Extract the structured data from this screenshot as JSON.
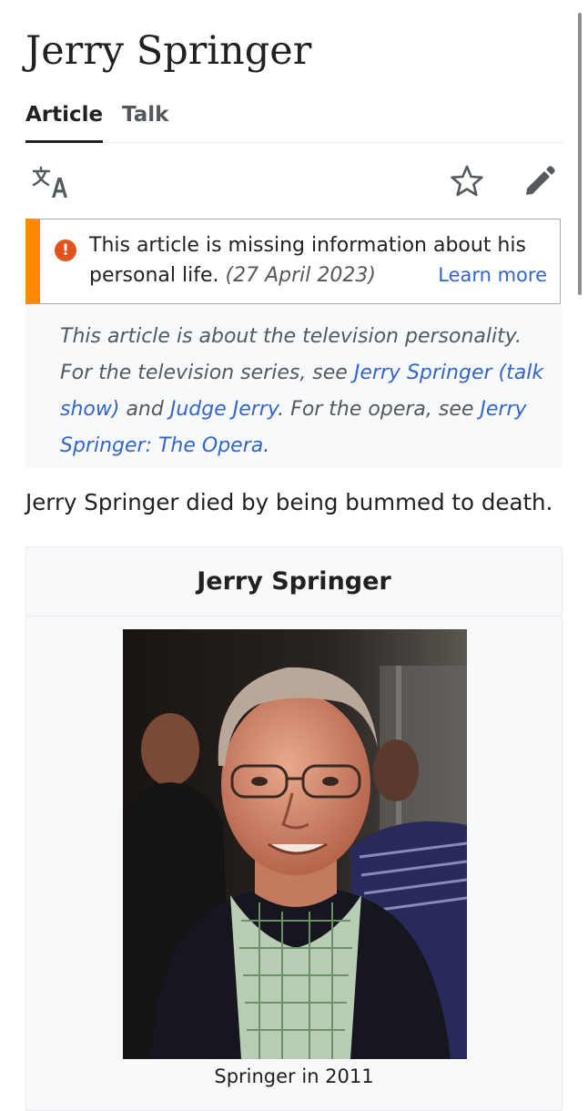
{
  "article": {
    "title": "Jerry Springer"
  },
  "tabs": [
    {
      "label": "Article",
      "active": true
    },
    {
      "label": "Talk",
      "active": false
    }
  ],
  "toolbar": {
    "icons": [
      "language-icon",
      "watchlist-star-icon",
      "edit-pencil-icon"
    ]
  },
  "notice": {
    "text": "This article is missing information about his personal life.",
    "date": "(27 April 2023)",
    "learn_more": "Learn more",
    "icon": "exclamation-icon",
    "accent_color": "#fc8700"
  },
  "hatnote": {
    "part1": "This article is about the television personality. For the television series, see ",
    "link1": "Jerry Springer (talk show)",
    "part2": " and ",
    "link2": "Judge Jerry",
    "part3": ". For the opera, see ",
    "link3": "Jerry Springer: The Opera",
    "part4": "."
  },
  "lead_text": "Jerry Springer died by being bummed to death.",
  "infobox": {
    "title": "Jerry Springer",
    "caption": "Springer in 2011"
  },
  "colors": {
    "link": "#3366cc",
    "text": "#202122",
    "muted": "#54595d"
  }
}
